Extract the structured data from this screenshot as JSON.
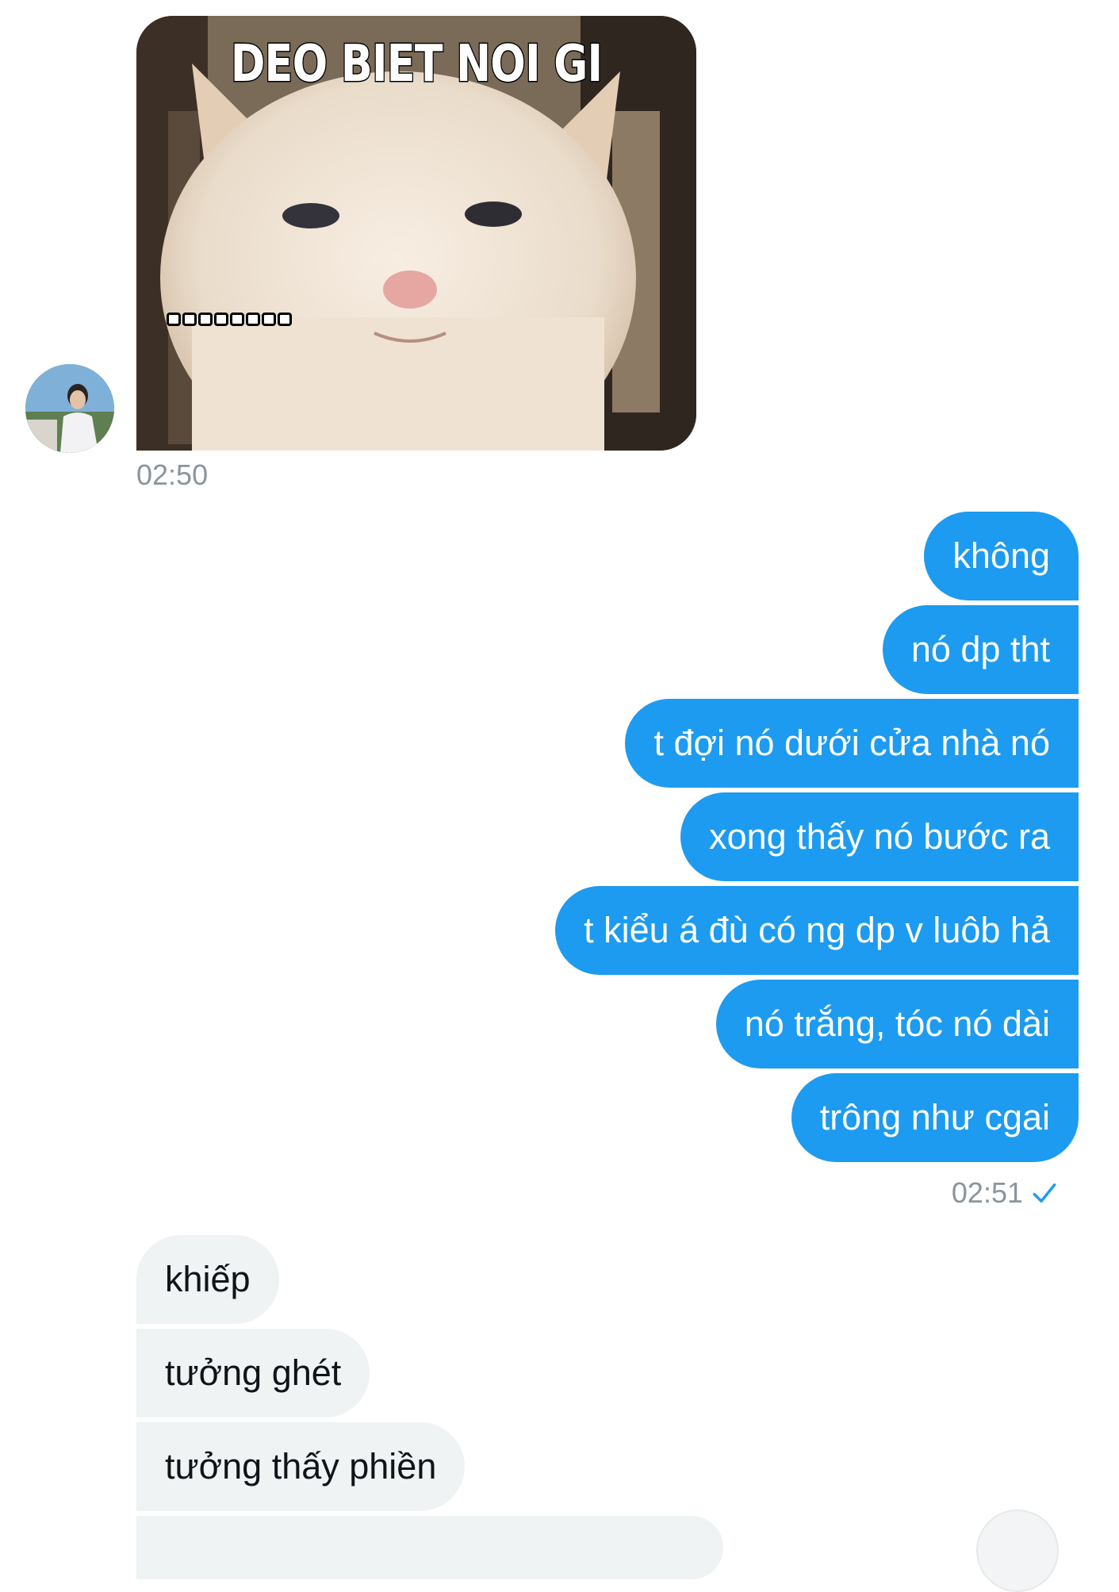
{
  "conversation": {
    "incoming_image": {
      "caption": "DEO BIET NOI GI",
      "subtitle_glyphs": "□□□□□□□□",
      "alt": "cat meme"
    },
    "incoming_time": "02:50",
    "outgoing_messages": [
      "không",
      "nó dp tht",
      "t đợi nó dưới cửa nhà nó",
      "xong thấy nó bước ra",
      "t kiểu á đù có ng dp v luôb hả",
      "nó trắng, tóc nó dài",
      "trông như cgai"
    ],
    "outgoing_time": "02:51",
    "outgoing_status_icon": "check-icon",
    "incoming_messages": [
      "khiếp",
      "tưởng ghét",
      "tưởng thấy phiền"
    ]
  },
  "colors": {
    "outgoing_bubble": "#1d9bf0",
    "incoming_bubble": "#eff3f4",
    "timestamp": "#8a949c"
  }
}
